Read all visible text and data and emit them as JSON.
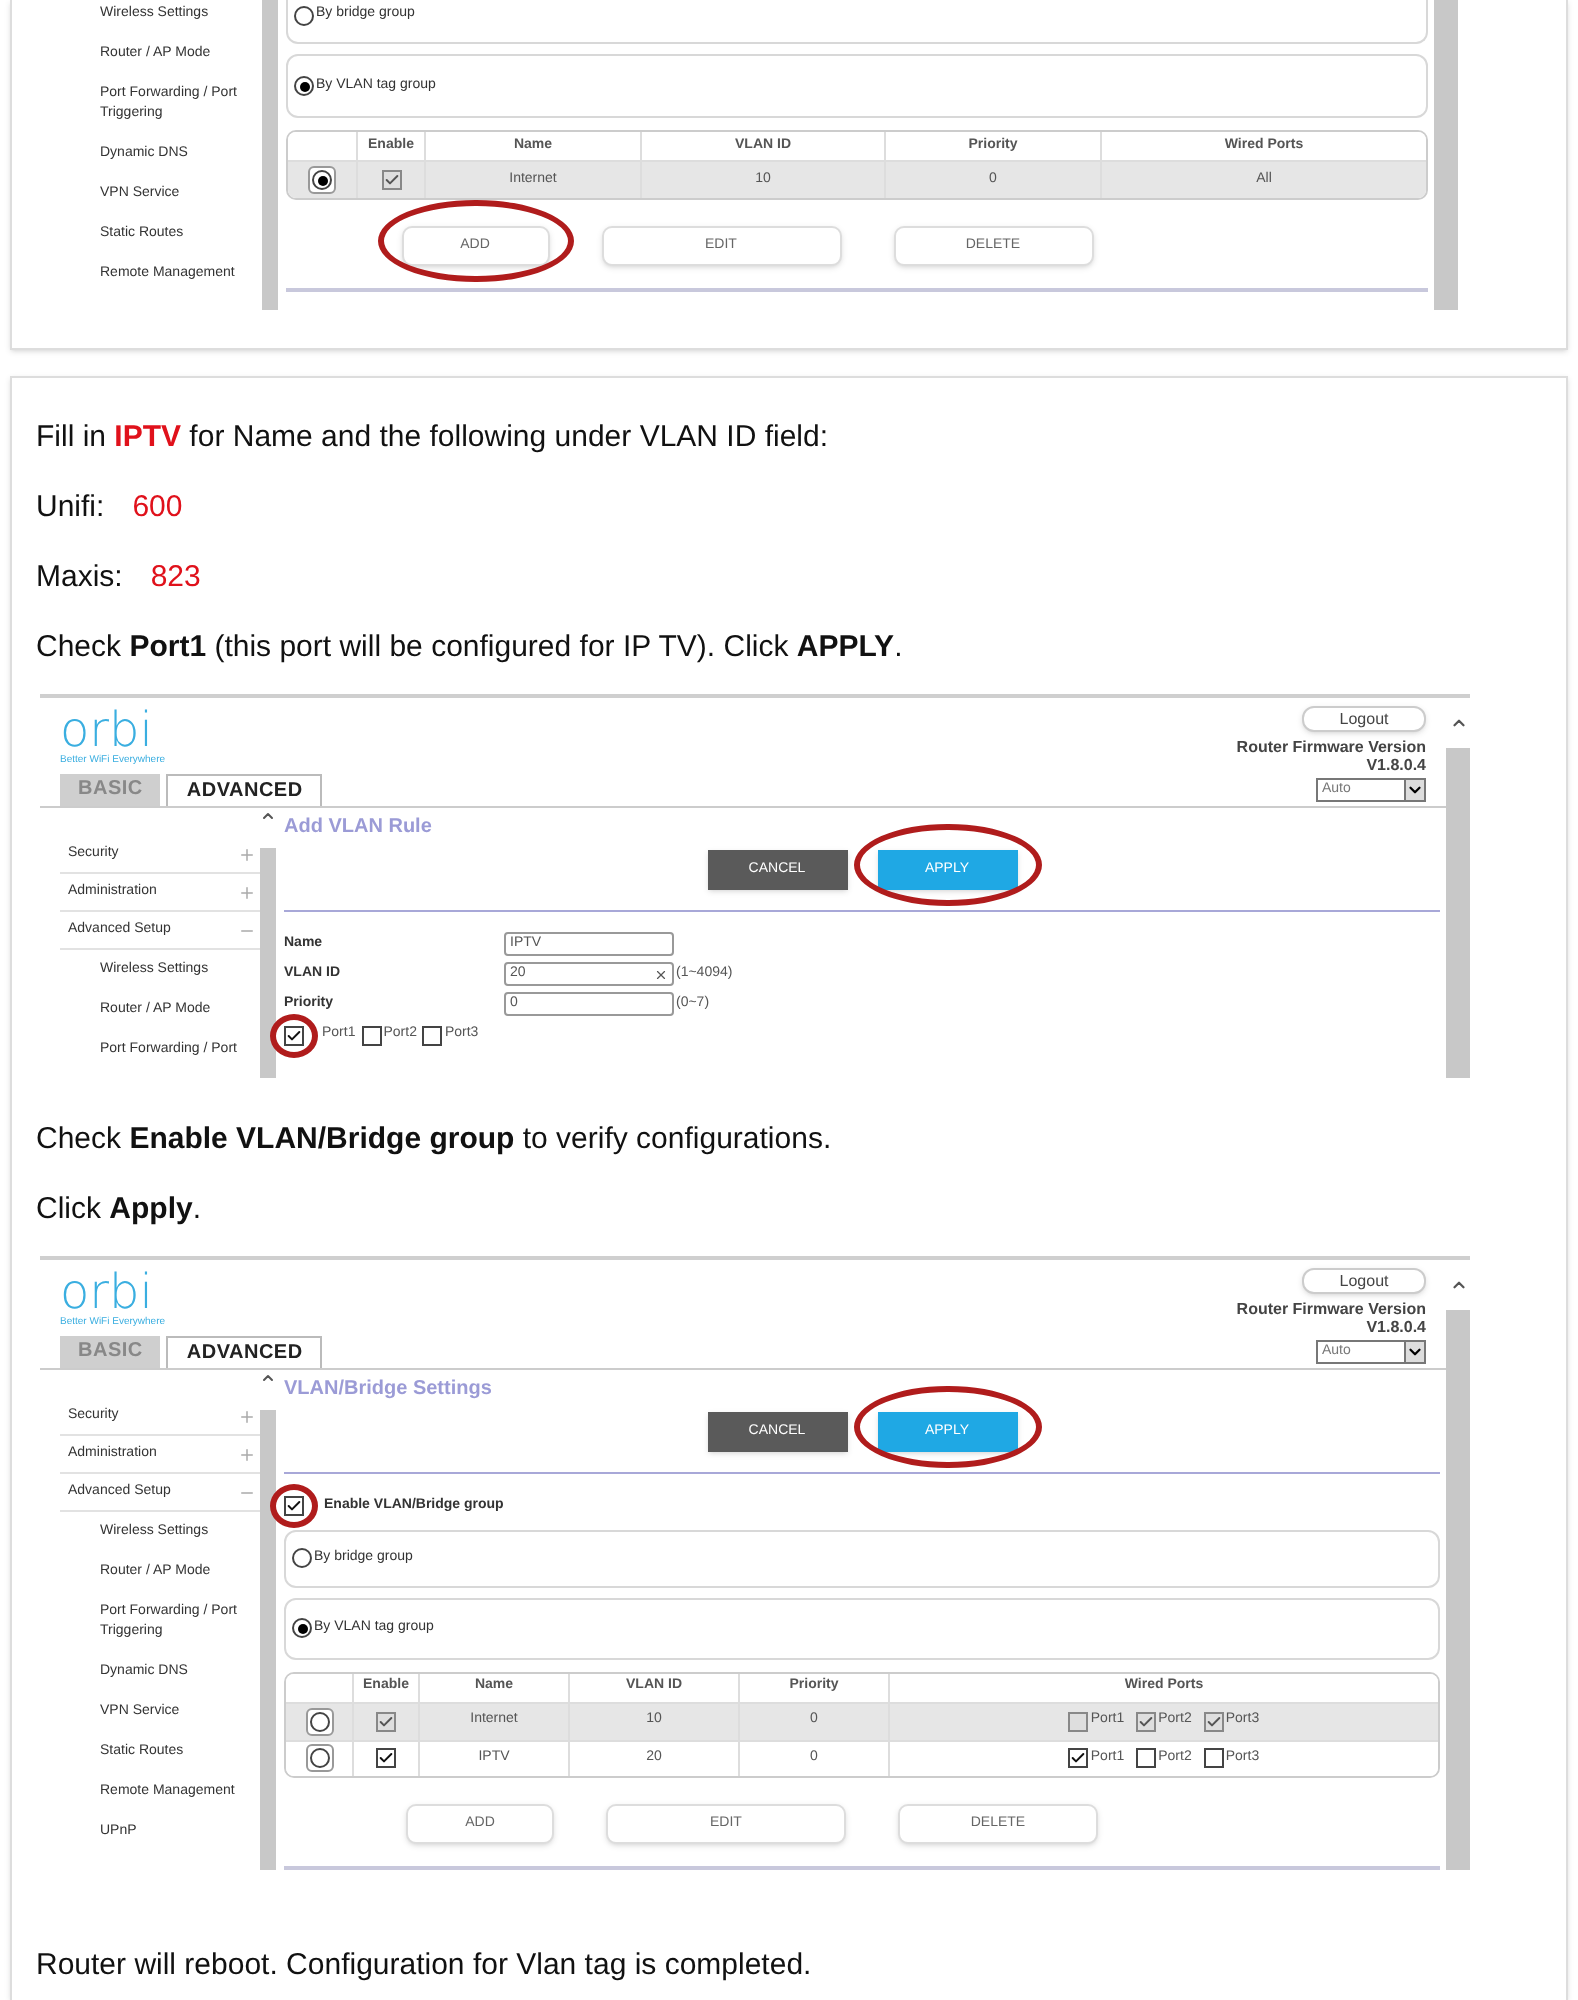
{
  "top_screen": {
    "sidebar": [
      {
        "kind": "page",
        "label": "Wireless Settings"
      },
      {
        "kind": "page",
        "label": "Router / AP Mode"
      },
      {
        "kind": "page",
        "label": "Port Forwarding / Port Triggering"
      },
      {
        "kind": "page",
        "label": "Dynamic DNS"
      },
      {
        "kind": "page",
        "label": "VPN Service"
      },
      {
        "kind": "page",
        "label": "Static Routes"
      },
      {
        "kind": "page",
        "label": "Remote Management"
      }
    ],
    "group_options": [
      {
        "label": "By bridge group",
        "selected": false
      },
      {
        "label": "By VLAN tag group",
        "selected": true
      }
    ],
    "table": {
      "columns": [
        "Enable",
        "Name",
        "VLAN ID",
        "Priority",
        "Wired Ports"
      ],
      "rows": [
        {
          "selected": true,
          "enable_checked": true,
          "enable_disabled": true,
          "name": "Internet",
          "vlan_id": "10",
          "priority": "0",
          "ports": {
            "kind": "text",
            "text": "All"
          }
        }
      ]
    },
    "table_buttons": [
      {
        "label": "ADD",
        "highlighted": true
      },
      {
        "label": "EDIT",
        "highlighted": false
      },
      {
        "label": "DELETE",
        "highlighted": false
      }
    ]
  },
  "blocks": [
    {
      "kind": "paragraph",
      "runs": [
        {
          "kind": "plain",
          "text": "Fill in "
        },
        {
          "kind": "red-bold",
          "text": "IPTV"
        },
        {
          "kind": "plain",
          "text": " for Name and the following under VLAN ID field:"
        }
      ]
    },
    {
      "kind": "paragraph",
      "runs": [
        {
          "kind": "plain",
          "text": "Unifi:"
        },
        {
          "kind": "red-value",
          "text": "600"
        }
      ]
    },
    {
      "kind": "paragraph",
      "runs": [
        {
          "kind": "plain",
          "text": "Maxis:"
        },
        {
          "kind": "red-value",
          "text": "823"
        }
      ]
    },
    {
      "kind": "paragraph",
      "runs": [
        {
          "kind": "plain",
          "text": "Check "
        },
        {
          "kind": "bold",
          "text": "Port1"
        },
        {
          "kind": "plain",
          "text": " (this port will be configured for IP TV). Click "
        },
        {
          "kind": "bold",
          "text": "APPLY"
        },
        {
          "kind": "plain",
          "text": "."
        }
      ]
    },
    {
      "kind": "screenshot",
      "screen": {
        "header": {
          "logo": "orbi",
          "tagline": "Better WiFi Everywhere",
          "tabs": [
            {
              "label": "BASIC",
              "selected": false
            },
            {
              "label": "ADVANCED",
              "selected": true
            }
          ],
          "logout": "Logout",
          "firmware_label": "Router Firmware Version",
          "firmware_version": "V1.8.0.4",
          "language": "Auto"
        },
        "sidebar": [
          {
            "kind": "section",
            "label": "Security",
            "expanded": false
          },
          {
            "kind": "section",
            "label": "Administration",
            "expanded": false
          },
          {
            "kind": "section",
            "label": "Advanced Setup",
            "expanded": true
          },
          {
            "kind": "page",
            "label": "Wireless Settings"
          },
          {
            "kind": "page",
            "label": "Router / AP Mode"
          },
          {
            "kind": "page",
            "label": "Port Forwarding / Port"
          }
        ],
        "title": "Add VLAN Rule",
        "actions": [
          {
            "kind": "cancel",
            "label": "CANCEL",
            "highlighted": false
          },
          {
            "kind": "apply",
            "label": "APPLY",
            "highlighted": true
          }
        ],
        "form": [
          {
            "label": "Name",
            "value": "IPTV",
            "clearable": false
          },
          {
            "label": "VLAN ID",
            "value": "20",
            "hint": "(1~4094)",
            "clearable": true
          },
          {
            "label": "Priority",
            "value": "0",
            "hint": "(0~7)",
            "clearable": false
          }
        ],
        "ports": [
          {
            "label": "Port1",
            "checked": true,
            "highlighted": true
          },
          {
            "label": "Port2",
            "checked": false,
            "highlighted": false
          },
          {
            "label": "Port3",
            "checked": false,
            "highlighted": false
          }
        ]
      }
    },
    {
      "kind": "paragraph",
      "runs": [
        {
          "kind": "plain",
          "text": "Check "
        },
        {
          "kind": "bold",
          "text": "Enable VLAN/Bridge group"
        },
        {
          "kind": "plain",
          "text": " to verify configurations."
        }
      ]
    },
    {
      "kind": "paragraph",
      "runs": [
        {
          "kind": "plain",
          "text": "Click "
        },
        {
          "kind": "bold",
          "text": "Apply"
        },
        {
          "kind": "plain",
          "text": "."
        }
      ]
    },
    {
      "kind": "screenshot",
      "screen": {
        "header": {
          "logo": "orbi",
          "tagline": "Better WiFi Everywhere",
          "tabs": [
            {
              "label": "BASIC",
              "selected": false
            },
            {
              "label": "ADVANCED",
              "selected": true
            }
          ],
          "logout": "Logout",
          "firmware_label": "Router Firmware Version",
          "firmware_version": "V1.8.0.4",
          "language": "Auto"
        },
        "sidebar": [
          {
            "kind": "section",
            "label": "Security",
            "expanded": false
          },
          {
            "kind": "section",
            "label": "Administration",
            "expanded": false
          },
          {
            "kind": "section",
            "label": "Advanced Setup",
            "expanded": true
          },
          {
            "kind": "page",
            "label": "Wireless Settings"
          },
          {
            "kind": "page",
            "label": "Router / AP Mode"
          },
          {
            "kind": "page",
            "label": "Port Forwarding / Port Triggering"
          },
          {
            "kind": "page",
            "label": "Dynamic DNS"
          },
          {
            "kind": "page",
            "label": "VPN Service"
          },
          {
            "kind": "page",
            "label": "Static Routes"
          },
          {
            "kind": "page",
            "label": "Remote Management"
          },
          {
            "kind": "page",
            "label": "UPnP"
          }
        ],
        "title": "VLAN/Bridge Settings",
        "actions": [
          {
            "kind": "cancel",
            "label": "CANCEL",
            "highlighted": false
          },
          {
            "kind": "apply",
            "label": "APPLY",
            "highlighted": true
          }
        ],
        "enable": {
          "label": "Enable VLAN/Bridge group",
          "checked": true,
          "highlighted": true
        },
        "group_options": [
          {
            "label": "By bridge group",
            "selected": false
          },
          {
            "label": "By VLAN tag group",
            "selected": true
          }
        ],
        "table": {
          "columns": [
            "Enable",
            "Name",
            "VLAN ID",
            "Priority",
            "Wired Ports"
          ],
          "rows": [
            {
              "selected": false,
              "enable_checked": true,
              "enable_disabled": true,
              "name": "Internet",
              "vlan_id": "10",
              "priority": "0",
              "ports": {
                "kind": "ports",
                "ports": [
                  {
                    "label": "Port1",
                    "checked": false
                  },
                  {
                    "label": "Port2",
                    "checked": true
                  },
                  {
                    "label": "Port3",
                    "checked": true
                  }
                ]
              }
            },
            {
              "selected": false,
              "enable_checked": true,
              "enable_disabled": false,
              "name": "IPTV",
              "vlan_id": "20",
              "priority": "0",
              "ports": {
                "kind": "ports",
                "ports": [
                  {
                    "label": "Port1",
                    "checked": true
                  },
                  {
                    "label": "Port2",
                    "checked": false
                  },
                  {
                    "label": "Port3",
                    "checked": false
                  }
                ]
              }
            }
          ]
        },
        "table_buttons": [
          {
            "label": "ADD",
            "highlighted": false
          },
          {
            "label": "EDIT",
            "highlighted": false
          },
          {
            "label": "DELETE",
            "highlighted": false
          }
        ]
      }
    },
    {
      "kind": "final",
      "runs": [
        {
          "kind": "plain",
          "text": "Router will reboot. Configuration for Vlan tag is completed."
        }
      ]
    }
  ]
}
